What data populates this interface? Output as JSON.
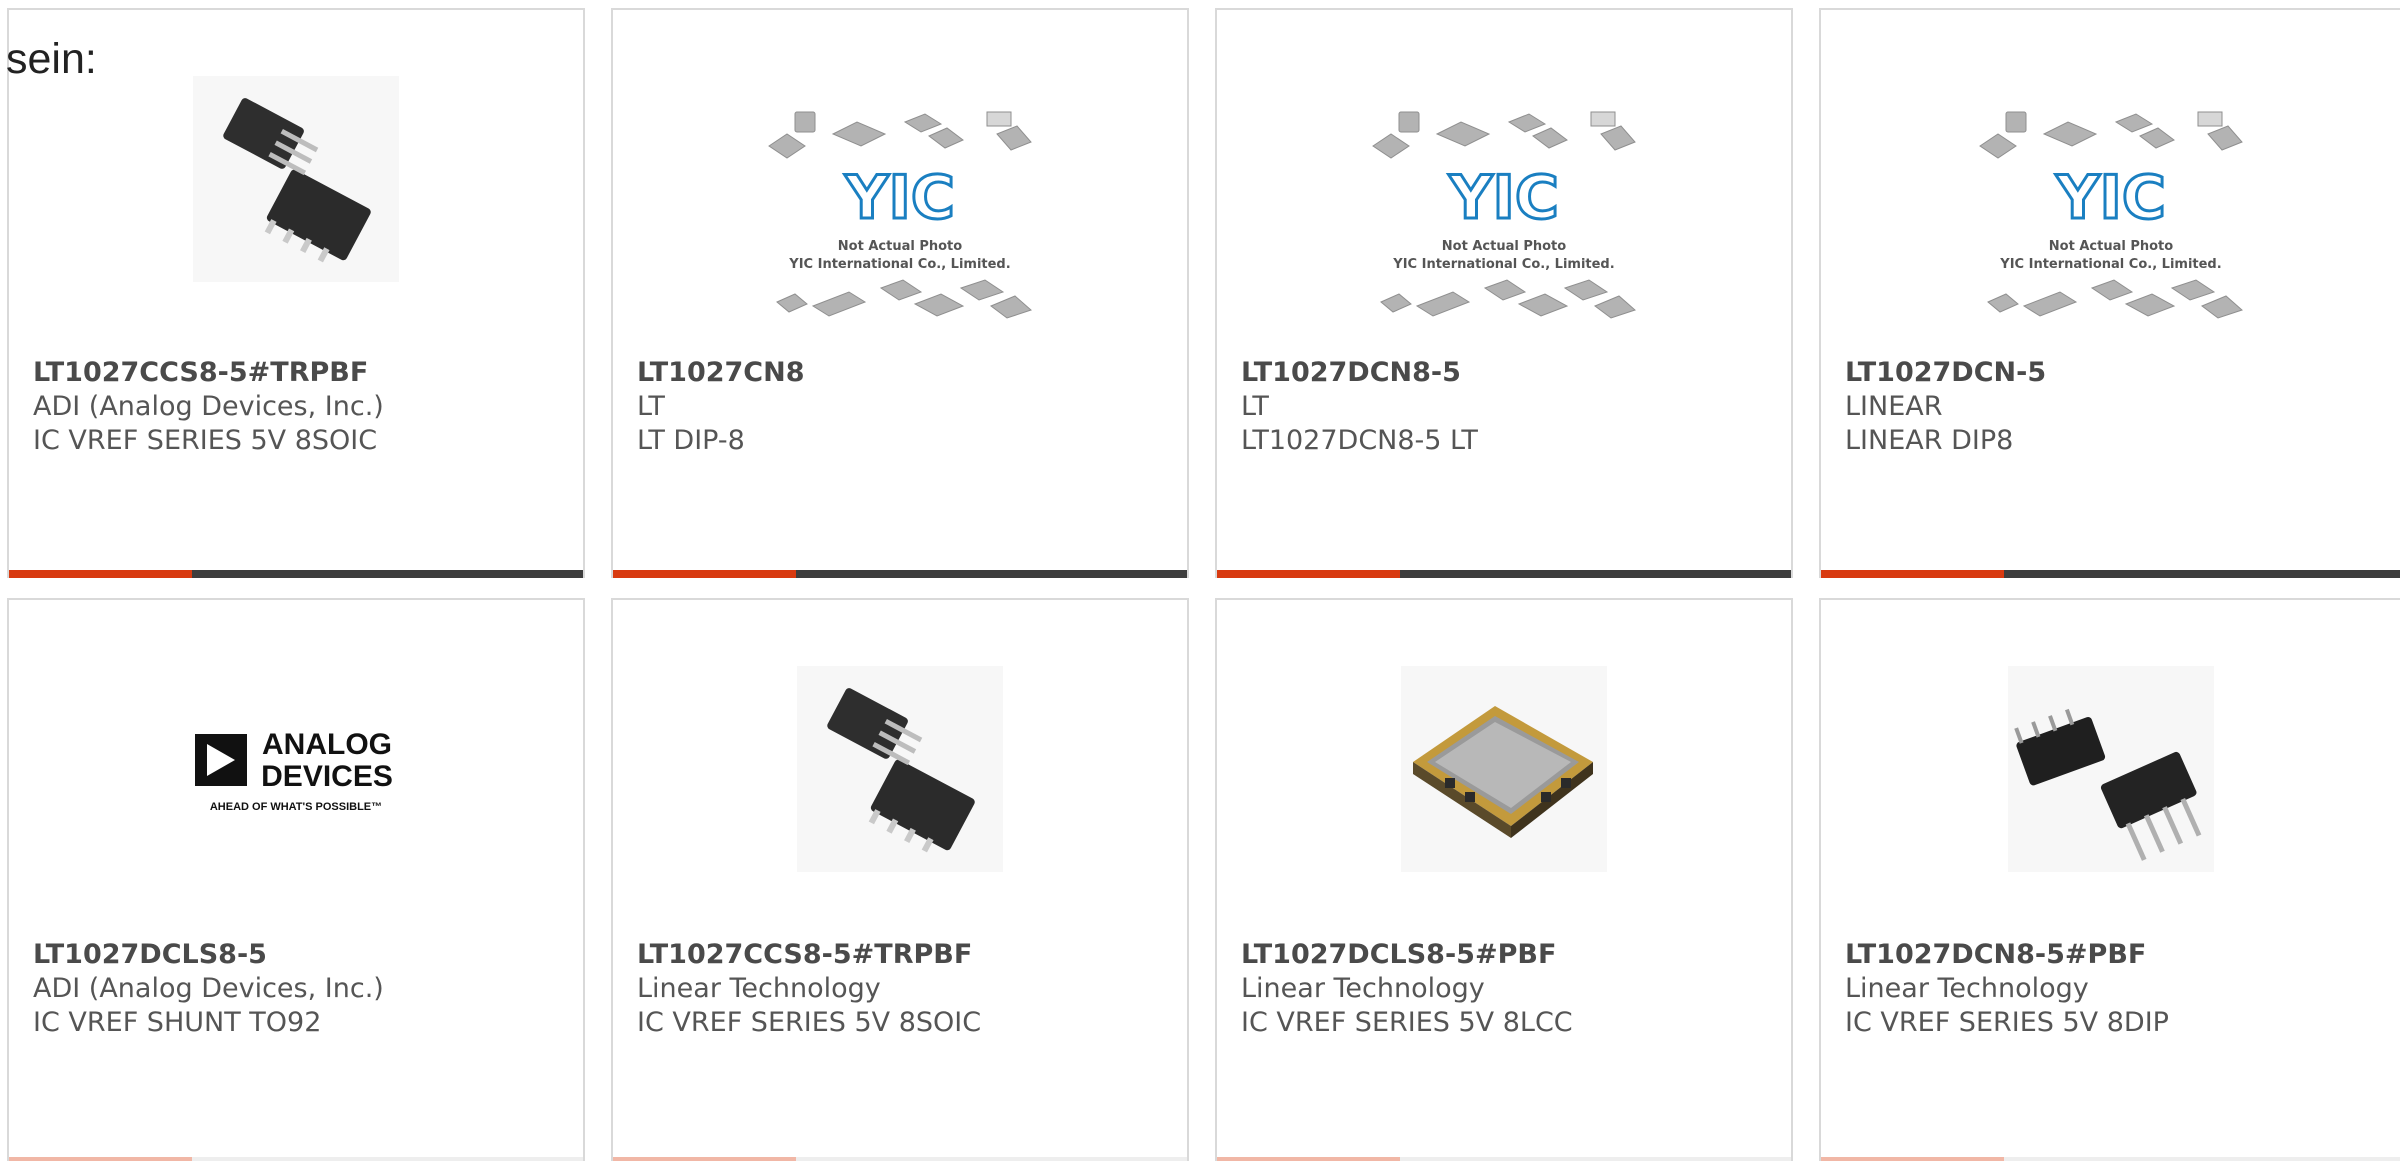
{
  "intro_text": "sein:",
  "colors": {
    "accent": "#d83a10",
    "bar": "#3d3d3d",
    "border": "#d9d9d9"
  },
  "products": [
    {
      "part": "LT1027CCS8-5#TRPBF",
      "manufacturer": "ADI (Analog Devices, Inc.)",
      "description": "IC VREF SERIES 5V 8SOIC",
      "image": "soic-chip-icon"
    },
    {
      "part": "LT1027CN8",
      "manufacturer": "LT",
      "description": "LT DIP-8",
      "image": "not-actual-photo-placeholder",
      "placeholder_logo": "YIC",
      "placeholder_line1": "Not Actual Photo",
      "placeholder_line2": "YIC International Co., Limited."
    },
    {
      "part": "LT1027DCN8-5",
      "manufacturer": "LT",
      "description": "LT1027DCN8-5 LT",
      "image": "not-actual-photo-placeholder",
      "placeholder_logo": "YIC",
      "placeholder_line1": "Not Actual Photo",
      "placeholder_line2": "YIC International Co., Limited."
    },
    {
      "part": "LT1027DCN-5",
      "manufacturer": "LINEAR",
      "description": "LINEAR DIP8",
      "image": "not-actual-photo-placeholder",
      "placeholder_logo": "YIC",
      "placeholder_line1": "Not Actual Photo",
      "placeholder_line2": "YIC International Co., Limited."
    },
    {
      "part": "LT1027DCLS8-5",
      "manufacturer": "ADI (Analog Devices, Inc.)",
      "description": "IC VREF SHUNT TO92",
      "image": "analog-devices-logo",
      "logo_line1": "ANALOG",
      "logo_line2": "DEVICES",
      "logo_tagline": "AHEAD OF WHAT'S POSSIBLE™"
    },
    {
      "part": "LT1027CCS8-5#TRPBF",
      "manufacturer": "Linear Technology",
      "description": "IC VREF SERIES 5V 8SOIC",
      "image": "soic-chip-icon"
    },
    {
      "part": "LT1027DCLS8-5#PBF",
      "manufacturer": "Linear Technology",
      "description": "IC VREF SERIES 5V 8LCC",
      "image": "lcc-chip-icon"
    },
    {
      "part": "LT1027DCN8-5#PBF",
      "manufacturer": "Linear Technology",
      "description": "IC VREF SERIES 5V 8DIP",
      "image": "dip-chip-icon"
    }
  ]
}
